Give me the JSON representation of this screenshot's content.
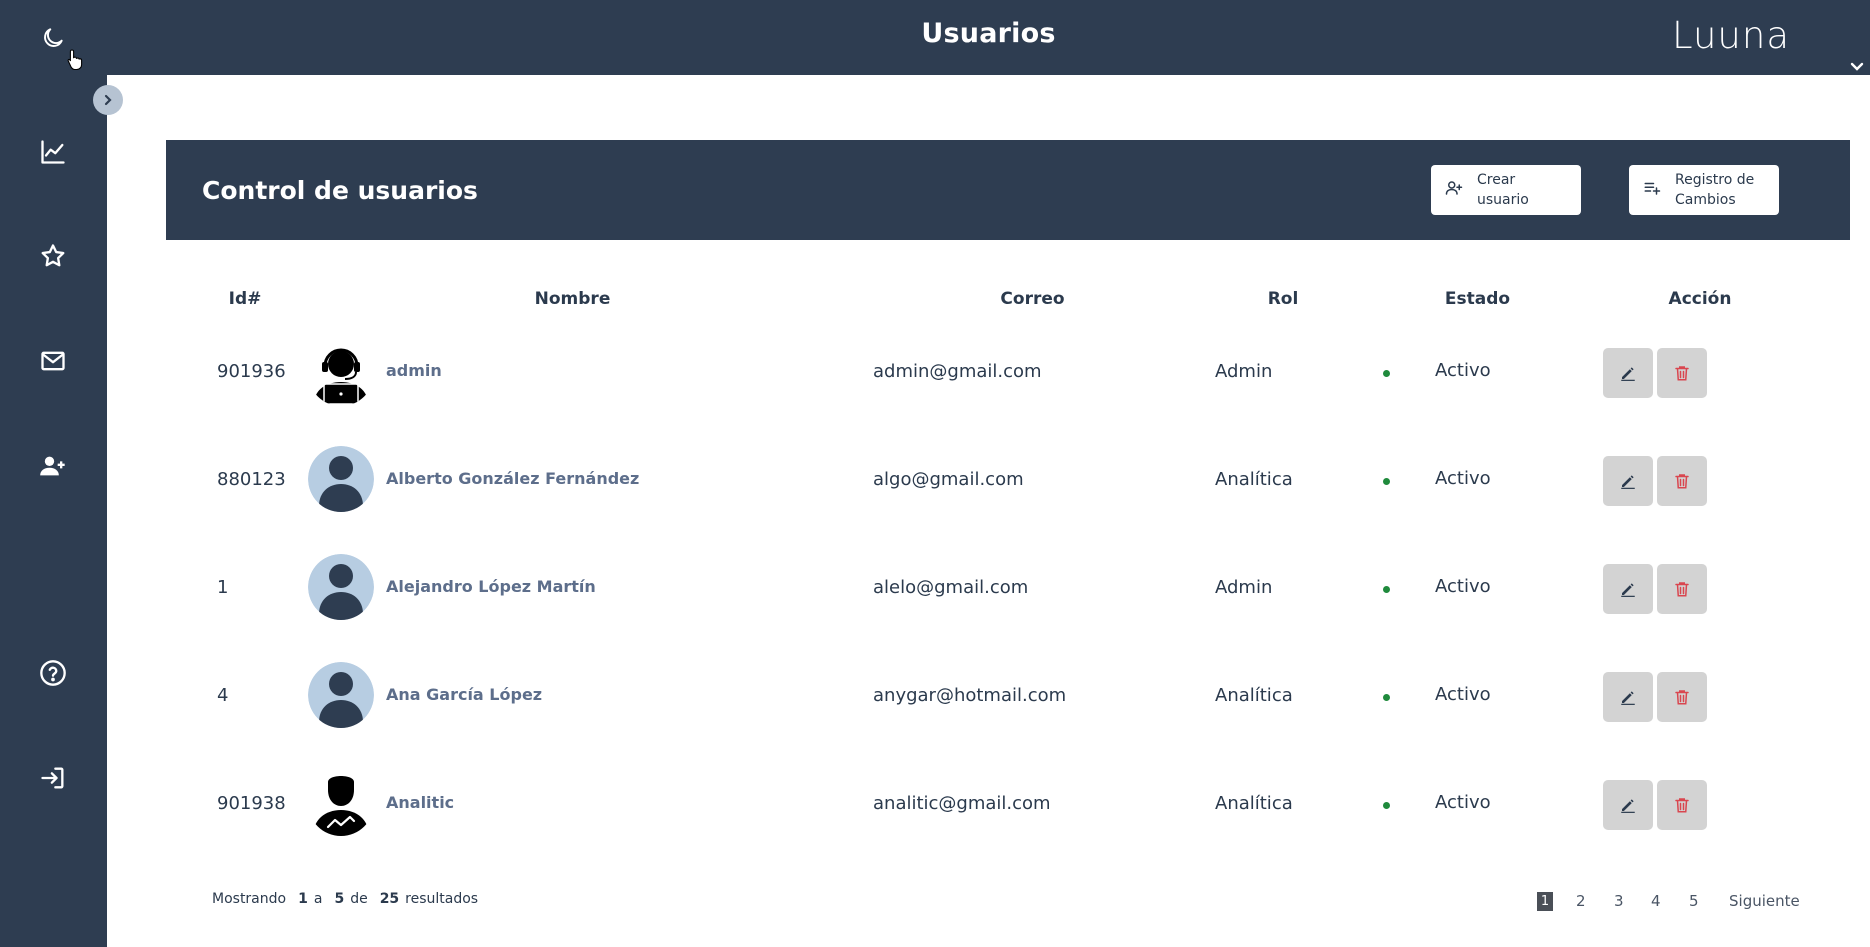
{
  "topbar": {
    "title": "Usuarios",
    "logo": "Luuna"
  },
  "sidebar": {
    "items": [
      {
        "icon": "moon-icon"
      },
      {
        "icon": "chart-line-icon"
      },
      {
        "icon": "star-icon"
      },
      {
        "icon": "mail-icon"
      },
      {
        "icon": "user-add-icon"
      },
      {
        "icon": "help-icon"
      },
      {
        "icon": "logout-icon"
      }
    ]
  },
  "panel": {
    "title": "Control de usuarios",
    "create_button": "Crear usuario",
    "log_button": "Registro de Cambios"
  },
  "table": {
    "headers": {
      "id": "Id#",
      "name": "Nombre",
      "email": "Correo",
      "role": "Rol",
      "status": "Estado",
      "action": "Acción"
    },
    "rows": [
      {
        "id": "901936",
        "name": "admin",
        "email": "admin@gmail.com",
        "role": "Admin",
        "status": "Activo",
        "avatar": "support-agent"
      },
      {
        "id": "880123",
        "name": "Alberto González Fernández",
        "email": "algo@gmail.com",
        "role": "Analítica",
        "status": "Activo",
        "avatar": "default-user"
      },
      {
        "id": "1",
        "name": "Alejandro López Martín",
        "email": "alelo@gmail.com",
        "role": "Admin",
        "status": "Activo",
        "avatar": "default-user"
      },
      {
        "id": "4",
        "name": "Ana García López",
        "email": "anygar@hotmail.com",
        "role": "Analítica",
        "status": "Activo",
        "avatar": "default-user"
      },
      {
        "id": "901938",
        "name": "Analitic",
        "email": "analitic@gmail.com",
        "role": "Analítica",
        "status": "Activo",
        "avatar": "analyst"
      }
    ]
  },
  "footer": {
    "showing": "Mostrando",
    "from": "1",
    "to_word": "a",
    "to": "5",
    "of_word": "de",
    "total": "25",
    "results": "resultados",
    "pages": [
      "1",
      "2",
      "3",
      "4",
      "5"
    ],
    "next": "Siguiente"
  },
  "colors": {
    "primary": "#2e3d51",
    "status_active": "#1f8a3c",
    "delete": "#d9464f"
  }
}
